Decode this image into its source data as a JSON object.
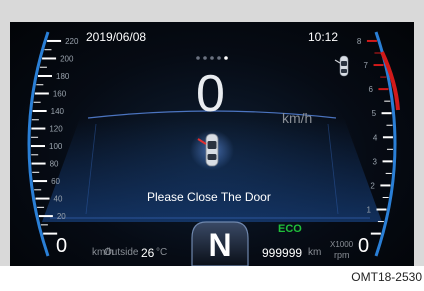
{
  "date": "2019/06/08",
  "time": "10:12",
  "speed": "0",
  "speed_unit": "km/h",
  "message": "Please Close The Door",
  "gear": "N",
  "mode": "ECO",
  "outside_label": "Outside",
  "outside_temp": "26",
  "temp_unit": "°C",
  "odometer": "999999",
  "odometer_unit": "km",
  "speedometer": {
    "ticks": [
      "220",
      "200",
      "180",
      "160",
      "140",
      "120",
      "100",
      "80",
      "60",
      "40",
      "20"
    ],
    "zero": "0",
    "unit": "km/h",
    "value": 0
  },
  "tachometer": {
    "ticks": [
      "8",
      "7",
      "6",
      "5",
      "4",
      "3",
      "2",
      "1"
    ],
    "zero": "0",
    "unit_top": "X1000",
    "unit_bottom": "rpm",
    "redline_start": 6,
    "value": 0
  },
  "page_dots": 5,
  "active_dot": 5,
  "figure_code": "OMT18-2530",
  "icons": [
    "car-door-open-icon",
    "car-top-icon",
    "page-indicator-dots"
  ],
  "colors": {
    "gauge_arc": "#2a7fd6",
    "redline": "#d11a1a",
    "eco": "#1fbf3a",
    "text": "#ffffff",
    "bezel": "#d9d9d9"
  }
}
